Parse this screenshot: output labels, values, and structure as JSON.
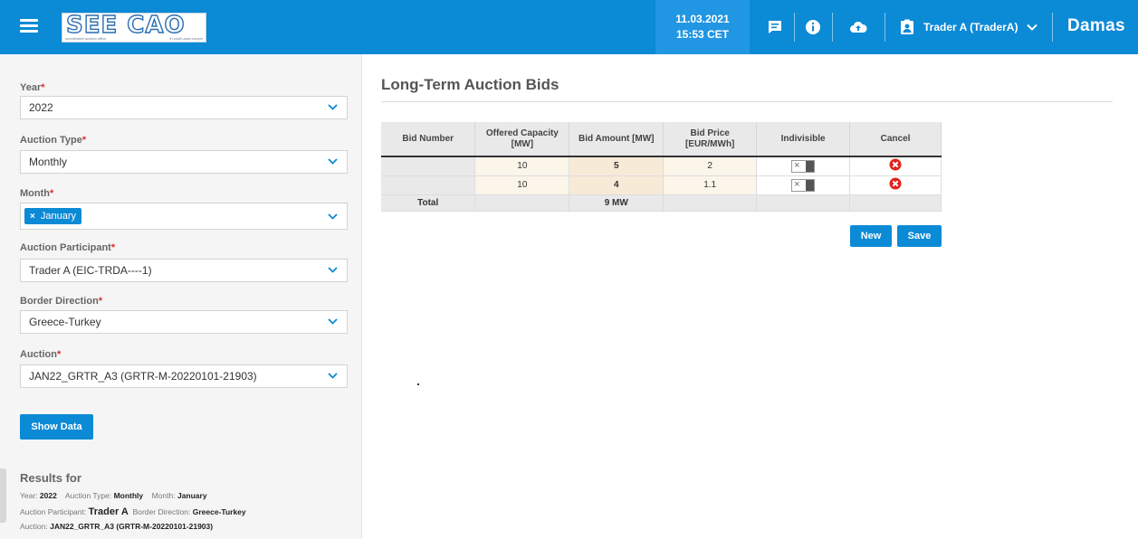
{
  "header": {
    "logo_text": "SEE CAO",
    "logo_sub_left": "coordinated auction office",
    "logo_sub_right": "in south-east europe",
    "date": "11.03.2021",
    "time": "15:53 CET",
    "user": "Trader A (TraderA)",
    "brand": "Damas",
    "color": "#0b8ad6"
  },
  "filters": {
    "year": {
      "label": "Year",
      "value": "2022"
    },
    "auction_type": {
      "label": "Auction Type",
      "value": "Monthly"
    },
    "month": {
      "label": "Month",
      "chip": "January"
    },
    "participant": {
      "label": "Auction Participant",
      "value": "Trader A (EIC-TRDA----1)"
    },
    "border": {
      "label": "Border Direction",
      "value": "Greece-Turkey"
    },
    "auction": {
      "label": "Auction",
      "value": "JAN22_GRTR_A3 (GRTR-M-20220101-21903)"
    },
    "show_button": "Show Data"
  },
  "results": {
    "title": "Results for",
    "year_label": "Year:",
    "year": "2022",
    "type_label": "Auction Type:",
    "type": "Monthly",
    "month_label": "Month:",
    "month": "January",
    "participant_label": "Auction Participant:",
    "participant": "Trader A",
    "border_label": "Border Direction:",
    "border": "Greece-Turkey",
    "auction_label": "Auction:",
    "auction": "JAN22_GRTR_A3 (GRTR-M-20220101-21903)"
  },
  "main": {
    "title": "Long-Term Auction Bids",
    "columns": [
      "Bid Number",
      "Offered Capacity [MW]",
      "Bid Amount [MW]",
      "Bid Price [EUR/MWh]",
      "Indivisible",
      "Cancel"
    ],
    "rows": [
      {
        "bid_number": "",
        "offered": "10",
        "amount": "5",
        "price": "2"
      },
      {
        "bid_number": "",
        "offered": "10",
        "amount": "4",
        "price": "1.1"
      }
    ],
    "total_label": "Total",
    "total_amount": "9 MW",
    "new_button": "New",
    "save_button": "Save"
  }
}
